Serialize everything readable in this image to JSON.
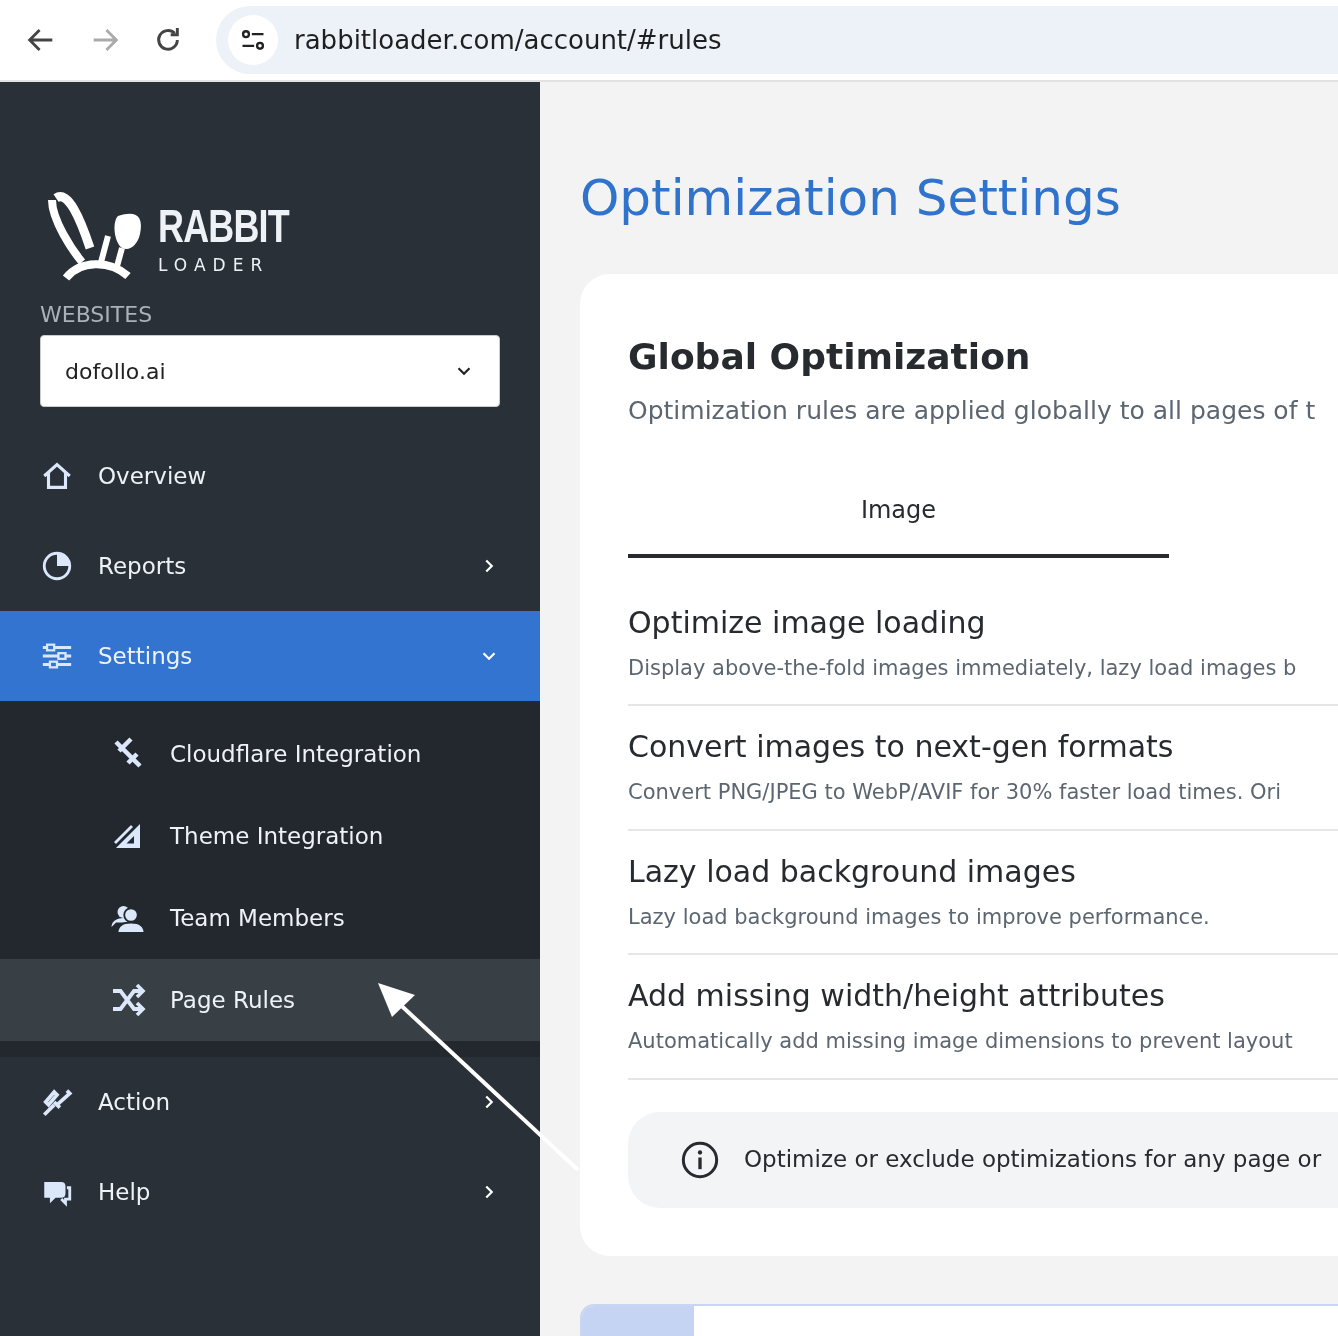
{
  "browser": {
    "url": "rabbitloader.com/account/#rules"
  },
  "sidebar": {
    "logo": {
      "word": "RABBIT",
      "sub": "LOADER"
    },
    "websites_label": "WEBSITES",
    "site_select": {
      "value": "dofollo.ai"
    },
    "items": [
      {
        "label": "Overview",
        "kind": "link",
        "selected": false
      },
      {
        "label": "Reports",
        "kind": "group",
        "expanded": false,
        "selected": false
      },
      {
        "label": "Settings",
        "kind": "group",
        "expanded": true,
        "selected": true,
        "children": [
          {
            "label": "Cloudflare Integration",
            "selected": false
          },
          {
            "label": "Theme Integration",
            "selected": false
          },
          {
            "label": "Team Members",
            "selected": false
          },
          {
            "label": "Page Rules",
            "selected": true
          }
        ]
      },
      {
        "label": "Action",
        "kind": "group",
        "expanded": false,
        "selected": false
      },
      {
        "label": "Help",
        "kind": "group",
        "expanded": false,
        "selected": false
      }
    ]
  },
  "main": {
    "title": "Optimization Settings",
    "card": {
      "title": "Global Optimization",
      "subtitle": "Optimization rules are applied globally to all pages of t",
      "tabs": [
        {
          "label": "Image",
          "selected": true
        }
      ],
      "settings": [
        {
          "title": "Optimize image loading",
          "description": "Display above-the-fold images immediately, lazy load images b"
        },
        {
          "title": "Convert images to next-gen formats",
          "description": "Convert PNG/JPEG to WebP/AVIF for 30% faster load times. Ori"
        },
        {
          "title": "Lazy load background images",
          "description": "Lazy load background images to improve performance."
        },
        {
          "title": "Add missing width/height attributes",
          "description": "Automatically add missing image dimensions to prevent layout"
        }
      ],
      "info": {
        "text": "Optimize or exclude optimizations for any page or"
      }
    }
  }
}
